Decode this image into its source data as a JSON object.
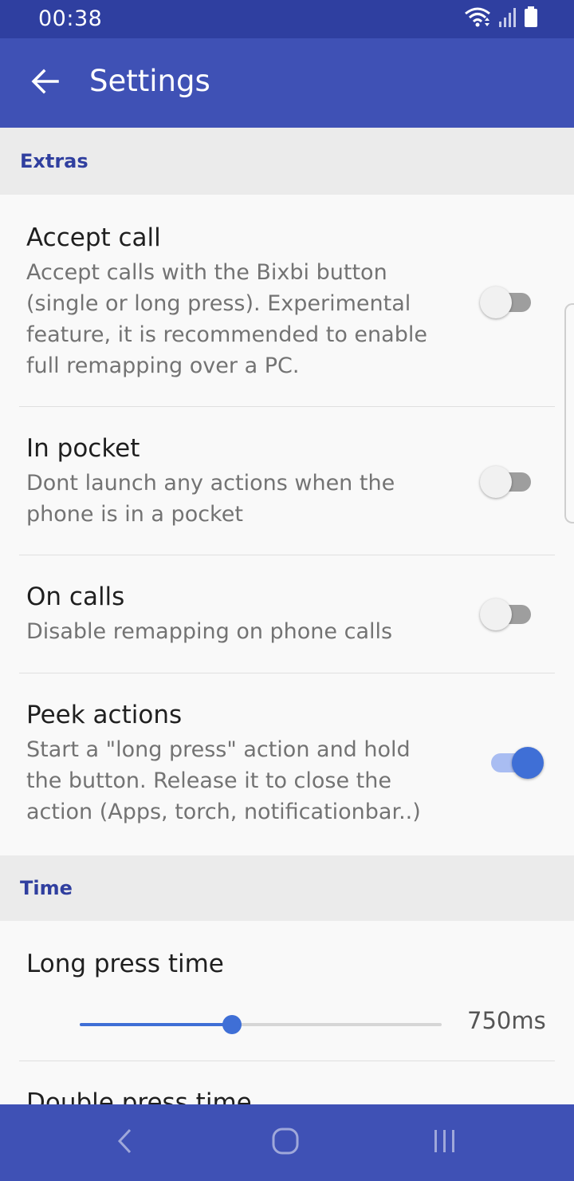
{
  "status_bar": {
    "time": "00:38",
    "icons": [
      "wifi-icon",
      "signal-icon",
      "battery-icon"
    ]
  },
  "app_bar": {
    "title": "Settings",
    "back_icon": "arrow-back-icon"
  },
  "sections": {
    "extras": {
      "header": "Extras"
    },
    "time": {
      "header": "Time"
    }
  },
  "prefs": {
    "accept_call": {
      "title": "Accept call",
      "summary": "Accept calls with the Bixbi button (single or long press). Experimental feature, it is recommended to enable full remapping over a PC.",
      "enabled": false
    },
    "in_pocket": {
      "title": "In pocket",
      "summary": "Dont launch any actions when the phone is in a pocket",
      "enabled": false
    },
    "on_calls": {
      "title": "On calls",
      "summary": "Disable remapping on phone calls",
      "enabled": false
    },
    "peek_actions": {
      "title": "Peek actions",
      "summary": "Start a \"long press\" action and hold the button. Release it to close the action (Apps, torch, notificationbar..)",
      "enabled": true
    },
    "long_press_time": {
      "title": "Long press time",
      "value_label": "750ms",
      "slider_fraction": 0.42
    },
    "double_press_time": {
      "title": "Double press time"
    }
  },
  "nav_bar": {
    "icons": [
      "nav-back-icon",
      "nav-home-icon",
      "nav-recents-icon"
    ]
  },
  "colors": {
    "primary": "#3f51b5",
    "primary_dark": "#2f3fa0",
    "accent": "#3f6fd6",
    "section_text": "#303f9f"
  }
}
